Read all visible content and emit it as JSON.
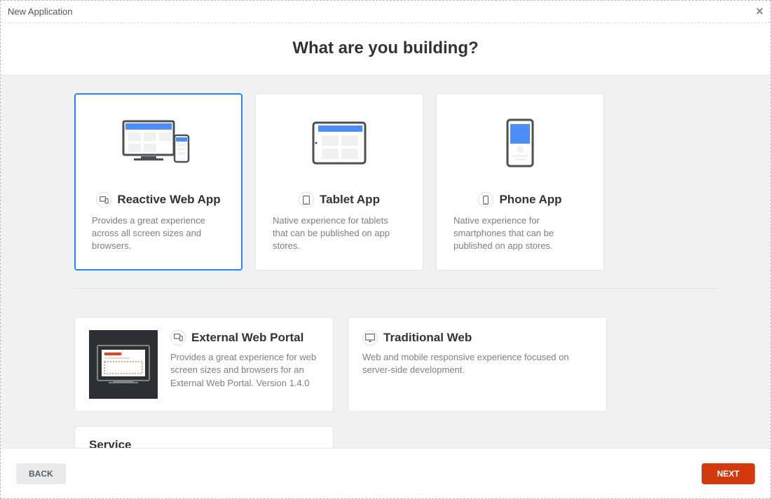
{
  "window": {
    "title": "New Application"
  },
  "header": {
    "heading": "What are you building?"
  },
  "top_cards": [
    {
      "id": "reactive",
      "icon": "devices-icon",
      "title": "Reactive Web App",
      "description": "Provides a great experience across all screen sizes and browsers.",
      "selected": true
    },
    {
      "id": "tablet",
      "icon": "tablet-icon",
      "title": "Tablet App",
      "description": "Native experience for tablets that can be published on app stores.",
      "selected": false
    },
    {
      "id": "phone",
      "icon": "phone-icon",
      "title": "Phone App",
      "description": "Native experience for smartphones that can be published on app stores.",
      "selected": false
    }
  ],
  "bottom_cards": [
    {
      "id": "external",
      "icon": "devices-icon",
      "title": "External Web Portal",
      "description": "Provides a great experience for web screen sizes and browsers for an External Web Portal. Version 1.4.0",
      "has_thumb": true
    },
    {
      "id": "traditional",
      "icon": "monitor-icon",
      "title": "Traditional Web",
      "description": "Web and mobile responsive experience focused on server-side development.",
      "has_thumb": false
    }
  ],
  "extra_card": {
    "id": "service",
    "title": "Service"
  },
  "footer": {
    "back_label": "BACK",
    "next_label": "NEXT"
  }
}
